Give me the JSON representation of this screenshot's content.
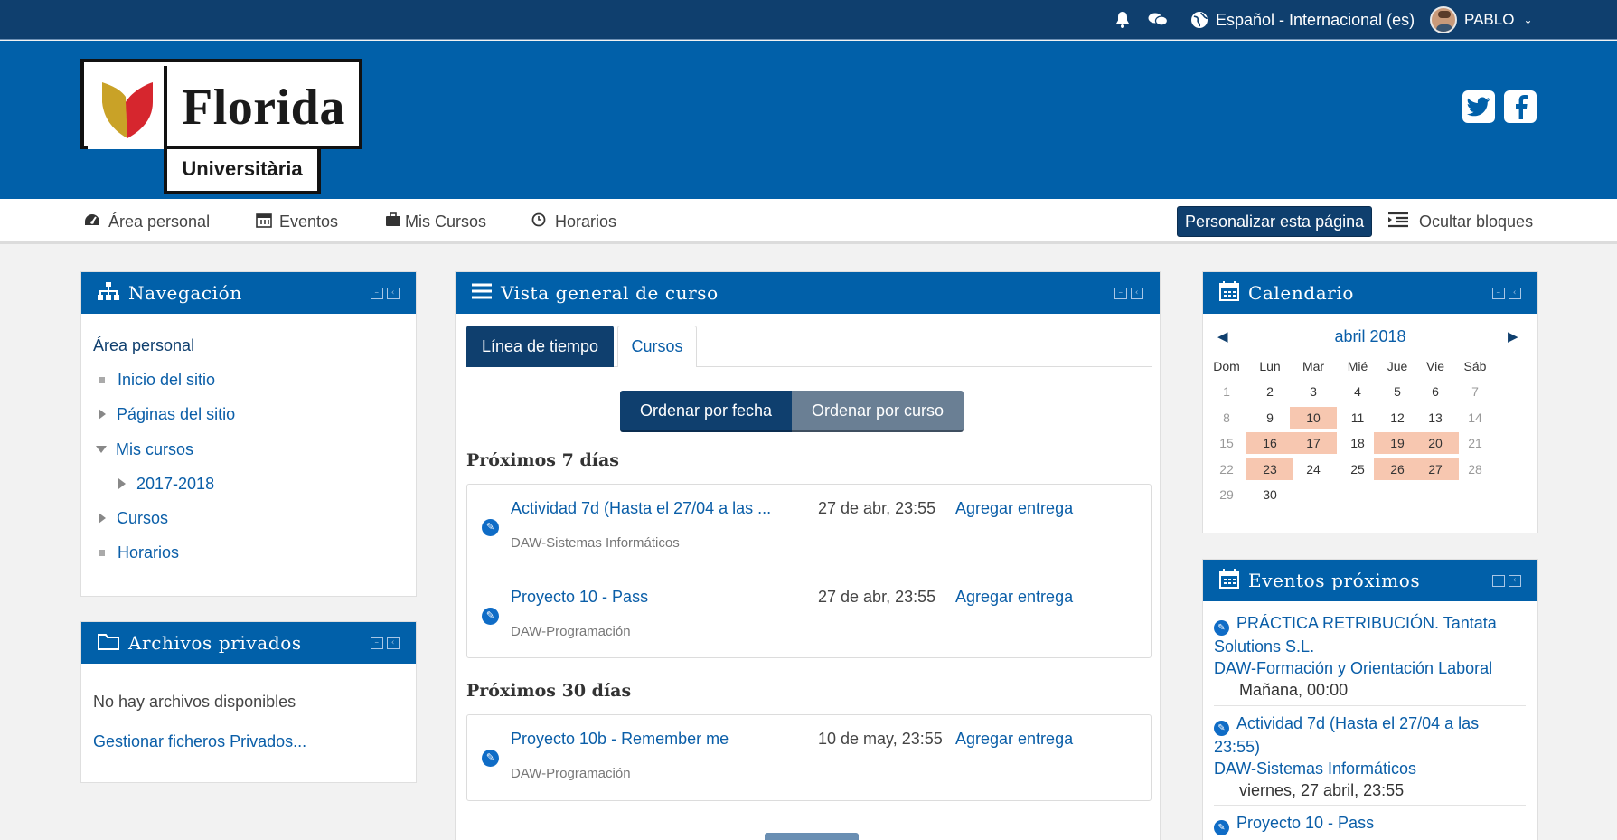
{
  "topbar": {
    "language": "Español - Internacional (es)",
    "user": "PABLO"
  },
  "header": {
    "logo_title": "Florida",
    "logo_subtitle": "Universitària",
    "social": [
      "twitter",
      "facebook"
    ]
  },
  "nav": {
    "items": [
      "Área personal",
      "Eventos",
      "Mis Cursos",
      "Horarios"
    ],
    "customize_label": "Personalizar esta página",
    "hide_blocks_label": "Ocultar bloques"
  },
  "navigation_block": {
    "title": "Navegación",
    "items": [
      "Área personal",
      "Inicio del sitio",
      "Páginas del sitio",
      "Mis cursos",
      "2017-2018",
      "Cursos",
      "Horarios"
    ]
  },
  "private_files_block": {
    "title": "Archivos privados",
    "empty_text": "No hay archivos disponibles",
    "manage_link": "Gestionar ficheros Privados..."
  },
  "course_overview": {
    "title": "Vista general de curso",
    "tabs": [
      "Línea de tiempo",
      "Cursos"
    ],
    "sort_buttons": [
      "Ordenar por fecha",
      "Ordenar por curso"
    ],
    "sections": [
      {
        "title": "Próximos 7 días",
        "events": [
          {
            "name": "Actividad 7d (Hasta el 27/04 a las ...",
            "course": "DAW-Sistemas Informáticos",
            "date": "27 de abr, 23:55",
            "action": "Agregar entrega"
          },
          {
            "name": "Proyecto 10 - Pass",
            "course": "DAW-Programación",
            "date": "27 de abr, 23:55",
            "action": "Agregar entrega"
          }
        ]
      },
      {
        "title": "Próximos 30 días",
        "events": [
          {
            "name": "Proyecto 10b - Remember me",
            "course": "DAW-Programación",
            "date": "10 de may, 23:55",
            "action": "Agregar entrega"
          }
        ]
      }
    ]
  },
  "calendar_block": {
    "title": "Calendario",
    "month": "abril 2018",
    "weekdays": [
      "Dom",
      "Lun",
      "Mar",
      "Mié",
      "Jue",
      "Vie",
      "Sáb"
    ],
    "weeks": [
      [
        "1",
        "2",
        "3",
        "4",
        "5",
        "6",
        "7"
      ],
      [
        "8",
        "9",
        "10",
        "11",
        "12",
        "13",
        "14"
      ],
      [
        "15",
        "16",
        "17",
        "18",
        "19",
        "20",
        "21"
      ],
      [
        "22",
        "23",
        "24",
        "25",
        "26",
        "27",
        "28"
      ],
      [
        "29",
        "30",
        "",
        "",
        "",
        "",
        ""
      ]
    ],
    "highlighted_days": [
      "10",
      "16",
      "17",
      "19",
      "20",
      "23",
      "26",
      "27"
    ],
    "highlight_color": "#f7c7b0"
  },
  "upcoming_block": {
    "title": "Eventos próximos",
    "events": [
      {
        "name": "PRÁCTICA RETRIBUCIÓN. Tantata Solutions S.L.",
        "course": "DAW-Formación y Orientación Laboral",
        "date": "Mañana, 00:00"
      },
      {
        "name": "Actividad 7d (Hasta el 27/04 a las 23:55)",
        "course": "DAW-Sistemas Informáticos",
        "date": "viernes, 27 abril, 23:55"
      },
      {
        "name": "Proyecto 10 - Pass",
        "course": "",
        "date": ""
      }
    ]
  },
  "colors": {
    "topbar": "#0f3f6e",
    "brand": "#0160a9",
    "link": "#0a5ea8"
  }
}
